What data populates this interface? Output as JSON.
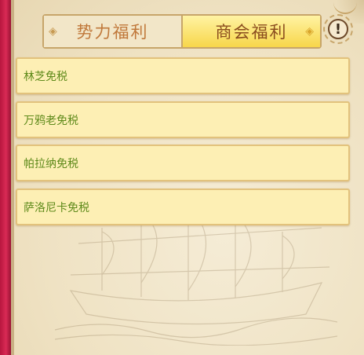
{
  "tabs": [
    {
      "label": "势力福利",
      "active": false
    },
    {
      "label": "商会福利",
      "active": true
    }
  ],
  "info_button": {
    "symbol": "!"
  },
  "benefits": [
    {
      "label": "林芝免税"
    },
    {
      "label": "万鸦老免税"
    },
    {
      "label": "帕拉纳免税"
    },
    {
      "label": "萨洛尼卡免税"
    }
  ],
  "colors": {
    "active_tab": "#f7d64a",
    "benefit_text": "#5e8a1a",
    "inactive_tab_text": "#c0783a",
    "side_strip": "#d92a55"
  },
  "icons": [
    "diamond-ornament-icon",
    "info-icon",
    "ship-watermark"
  ]
}
